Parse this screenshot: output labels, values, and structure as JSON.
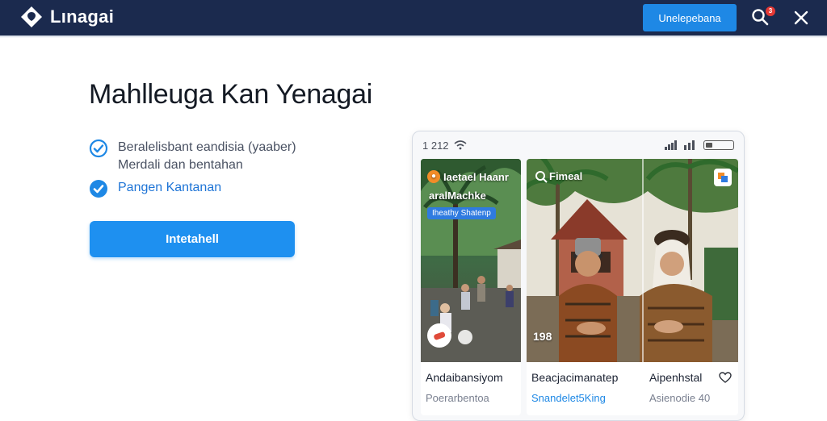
{
  "app": {
    "brand": "Lınagai",
    "cta_label": "Unelepebana",
    "notification_count": "3"
  },
  "hero": {
    "title": "Mahlleuga Kan Yenagai",
    "features": [
      {
        "line1": "Beralelisbant eandisia (yaaber)",
        "line2": "Merdali dan bentahan"
      },
      {
        "line1": "Pangen Kantanan"
      }
    ],
    "install_label": "Intetahell"
  },
  "phone": {
    "time": "1 212",
    "cards": [
      {
        "overlay_title": "Iaetael Haanr",
        "overlay_sub": "aralMachke",
        "overlay_pill": "Iheathy Shatenp",
        "title": "Andaibansiyom",
        "subtitle": "Poerarbentoa"
      },
      {
        "overlay_title": "Fimeal",
        "number": "198",
        "title_left": "Beacjacimanatep",
        "subtitle_left": "Snandelet5King",
        "title_right": "Aipenhstal",
        "subtitle_right": "Asienodie 40"
      }
    ]
  },
  "colors": {
    "topbar": "#1b2a4e",
    "accent": "#1e88e5",
    "badge": "#e53935"
  }
}
